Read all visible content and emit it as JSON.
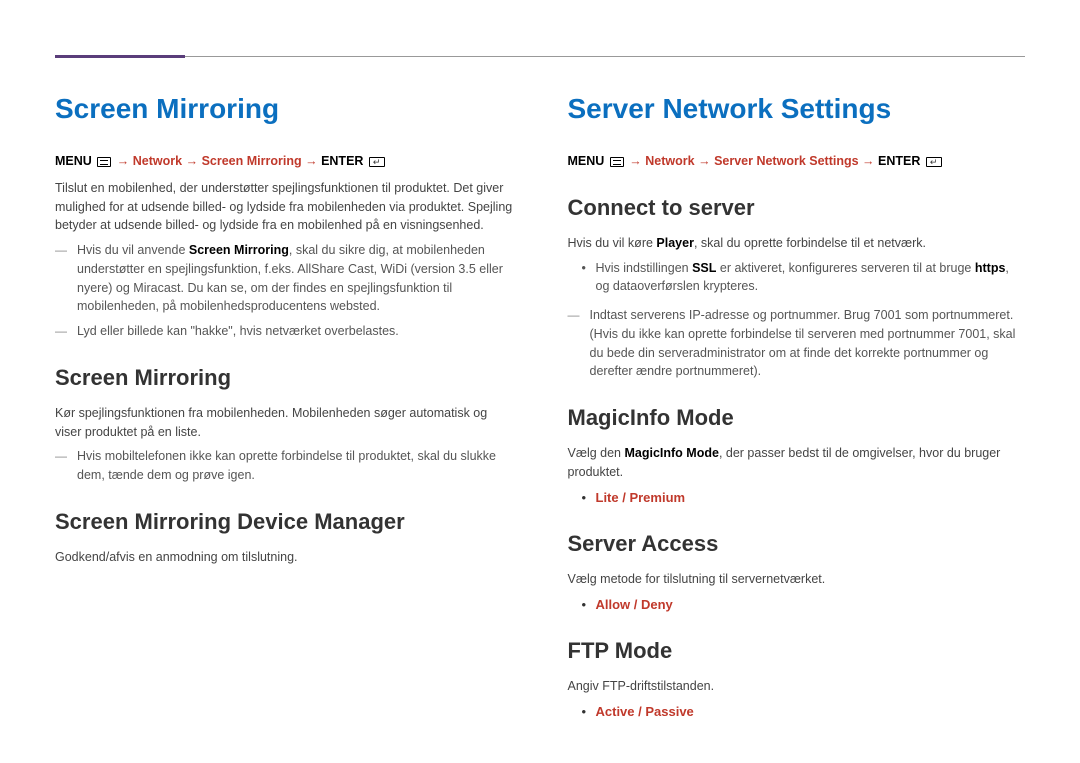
{
  "left": {
    "title": "Screen Mirroring",
    "nav": {
      "menu": "MENU",
      "path": [
        "Network",
        "Screen Mirroring"
      ],
      "enter": "ENTER"
    },
    "intro": "Tilslut en mobilenhed, der understøtter spejlingsfunktionen til produktet. Det giver mulighed for at udsende billed- og lydside fra mobilenheden via produktet. Spejling betyder at udsende billed- og lydside fra en mobilenhed på en visningsenhed.",
    "notes": [
      {
        "pre": "Hvis du vil anvende ",
        "bold": "Screen Mirroring",
        "post": ", skal du sikre dig, at mobilenheden understøtter en spejlingsfunktion, f.eks. AllShare Cast, WiDi (version 3.5 eller nyere) og Miracast. Du kan se, om der findes en spejlingsfunktion til mobilenheden, på mobilenhedsproducentens websted."
      },
      {
        "text": "Lyd eller billede kan \"hakke\", hvis netværket overbelastes."
      }
    ],
    "sub1": {
      "title": "Screen Mirroring",
      "text": "Kør spejlingsfunktionen fra mobilenheden. Mobilenheden søger automatisk og viser produktet på en liste.",
      "note": "Hvis mobiltelefonen ikke kan oprette forbindelse til produktet, skal du slukke dem, tænde dem og prøve igen."
    },
    "sub2": {
      "title": "Screen Mirroring Device Manager",
      "text": "Godkend/afvis en anmodning om tilslutning."
    }
  },
  "right": {
    "title": "Server Network Settings",
    "nav": {
      "menu": "MENU",
      "path": [
        "Network",
        "Server Network Settings"
      ],
      "enter": "ENTER"
    },
    "connect": {
      "title": "Connect to server",
      "text_pre": "Hvis du vil køre ",
      "text_bold": "Player",
      "text_post": ", skal du oprette forbindelse til et netværk.",
      "bullet_pre": "Hvis indstillingen ",
      "bullet_bold": "SSL",
      "bullet_mid": " er aktiveret, konfigureres serveren til at bruge ",
      "bullet_bold2": "https",
      "bullet_post": ", og dataoverførslen krypteres.",
      "note": "Indtast serverens IP-adresse og portnummer. Brug 7001 som portnummeret. (Hvis du ikke kan oprette forbindelse til serveren med portnummer 7001, skal du bede din serveradministrator om at finde det korrekte portnummer og derefter ændre portnummeret)."
    },
    "magic": {
      "title": "MagicInfo Mode",
      "text_pre": "Vælg den ",
      "text_bold": "MagicInfo Mode",
      "text_post": ", der passer bedst til de omgivelser, hvor du bruger produktet.",
      "options": "Lite / Premium"
    },
    "access": {
      "title": "Server Access",
      "text": "Vælg metode for tilslutning til servernetværket.",
      "options": "Allow / Deny"
    },
    "ftp": {
      "title": "FTP Mode",
      "text": "Angiv FTP-driftstilstanden.",
      "options": "Active / Passive"
    }
  }
}
